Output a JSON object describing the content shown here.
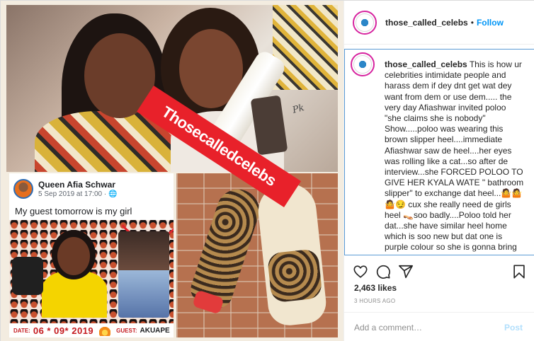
{
  "post": {
    "username": "those_called_celebs",
    "follow_label": "Follow",
    "separator": "•"
  },
  "media": {
    "watermark": "Thosecalledcelebs",
    "signature": "Pk",
    "fb_card": {
      "name": "Queen Afia Schwar",
      "date": "5 Sep 2019 at 17:00 · 🌐",
      "text": "My guest tomorrow is my girl",
      "date_label": "DATE:",
      "date_value": "06 * 09* 2019",
      "guest_label": "GUEST:",
      "guest_value": "AKUAPE"
    }
  },
  "caption": {
    "username": "those_called_celebs",
    "text": " This is how ur celebrities intimidate people and harass dem if dey dnt get wat dey want from dem or use dem..... the very day Afiashwar invited poloo \"she claims she is nobody\" Show.....poloo was wearing this brown slipper heel....immediate Afiashwar saw de heel....her eyes was rolling like a cat...so after de interview...she FORCED POLOO TO GIVE HER KYALA WATE \" bathroom slipper\" to exchange dat heel...🤷🤷🤷😏 cux she really need de girls heel 👡soo badly....Poloo told her dat...she have similar heel home which is soo new but dat one is purple colour so she is gonna bring her dat one instead of de one she is wearing...she drove home n"
  },
  "actions": {
    "icons": [
      "heart-icon",
      "comment-icon",
      "share-icon",
      "bookmark-icon"
    ],
    "likes": "2,463 likes",
    "time": "3 HOURS AGO"
  },
  "composer": {
    "placeholder": "Add a comment…",
    "post_label": "Post"
  },
  "colors": {
    "accent": "#0095f6",
    "post_disabled": "#b2dffc",
    "watermark_red": "#e8212a"
  }
}
